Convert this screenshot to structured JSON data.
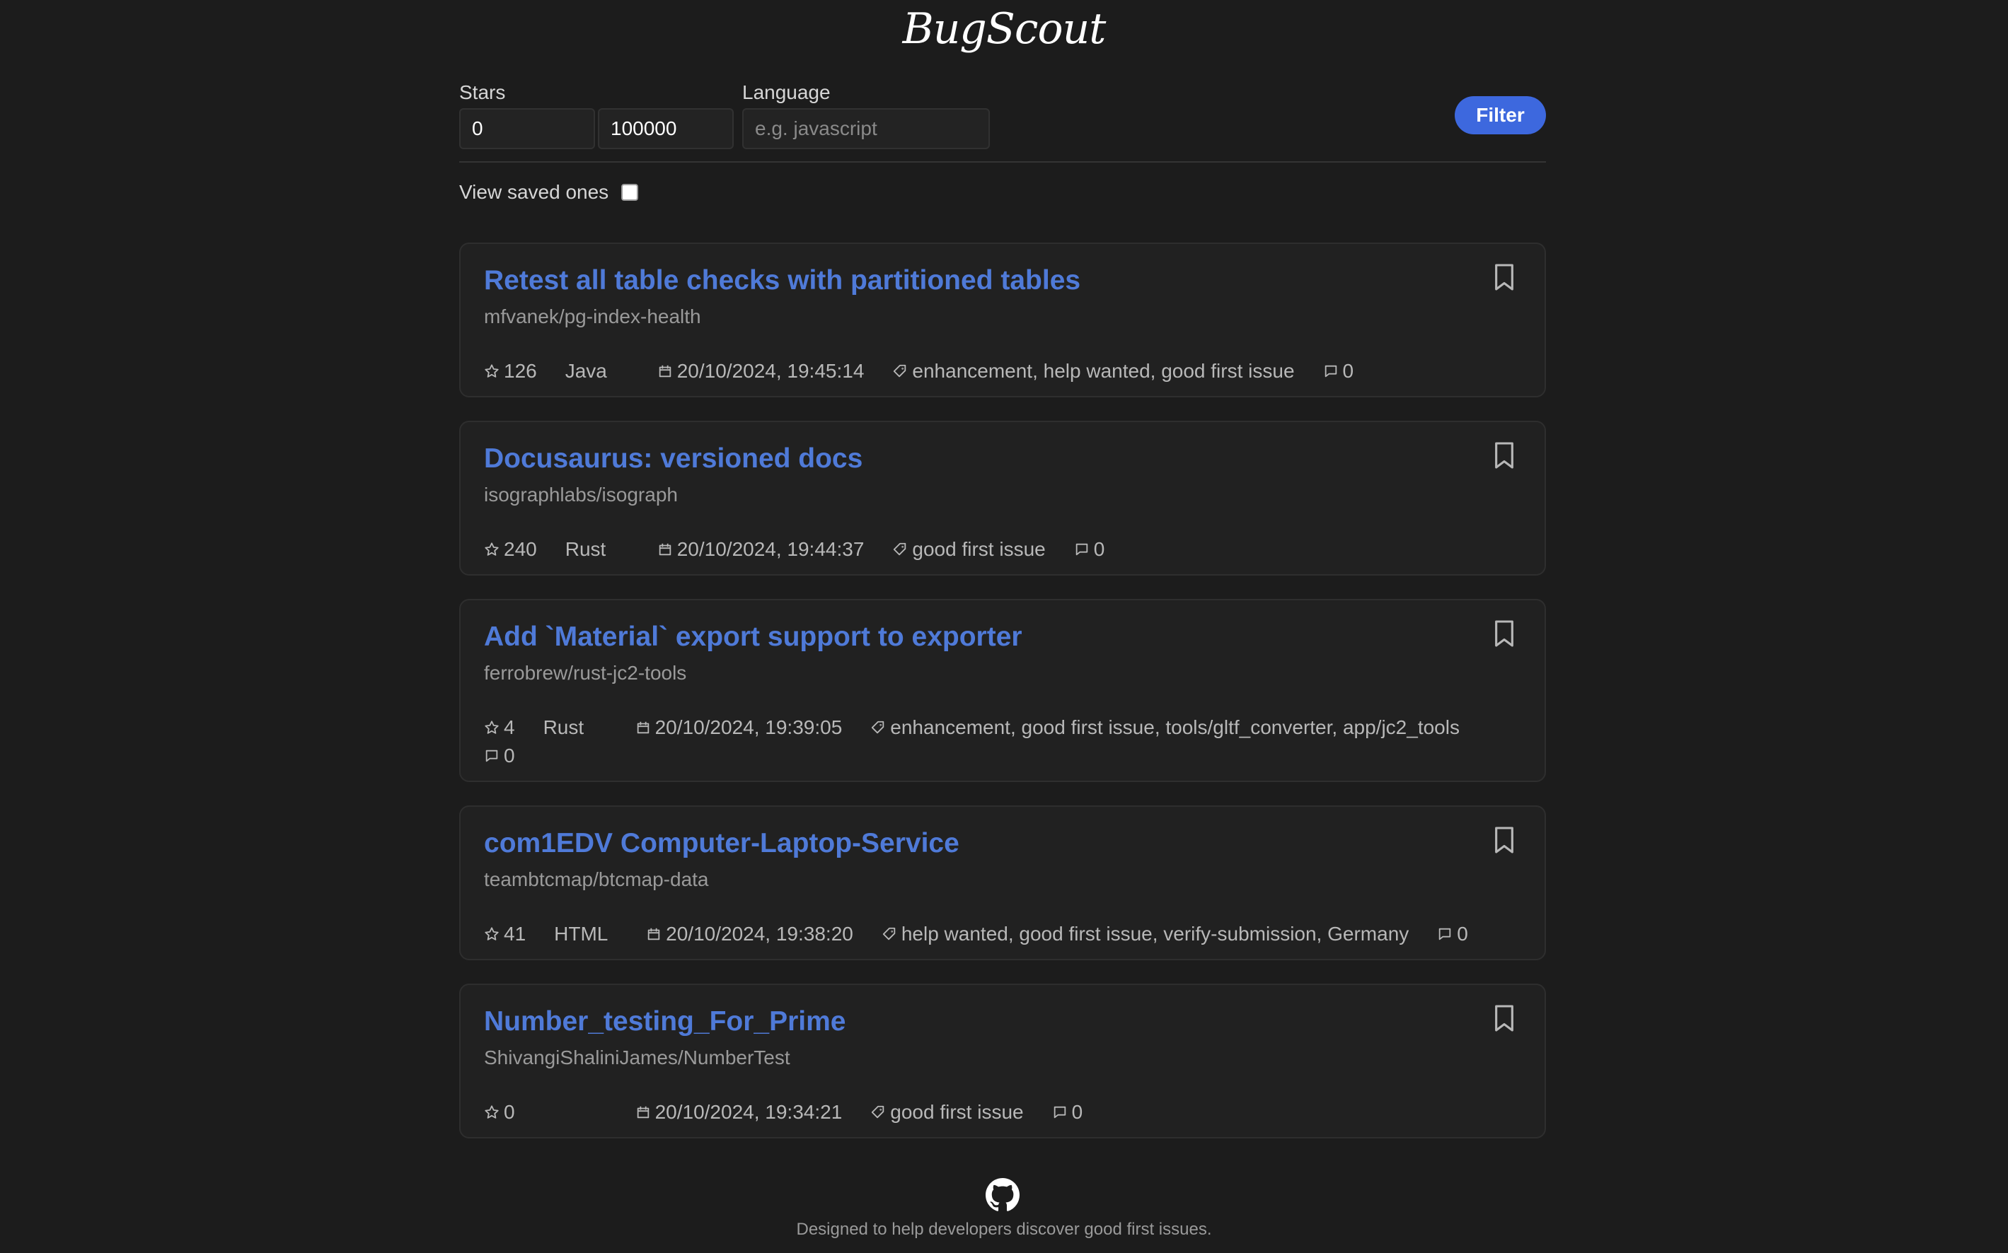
{
  "app": {
    "title": "BugScout"
  },
  "filters": {
    "stars_label": "Stars",
    "stars_min": "0",
    "stars_max": "100000",
    "language_label": "Language",
    "language_placeholder": "e.g. javascript",
    "filter_button": "Filter"
  },
  "saved": {
    "label": "View saved ones",
    "checked": false
  },
  "issues": [
    {
      "title": "Retest all table checks with partitioned tables",
      "repo": "mfvanek/pg-index-health",
      "stars": "126",
      "language": "Java",
      "date": "20/10/2024, 19:45:14",
      "labels": "enhancement, help wanted, good first issue",
      "comments": "0"
    },
    {
      "title": "Docusaurus: versioned docs",
      "repo": "isographlabs/isograph",
      "stars": "240",
      "language": "Rust",
      "date": "20/10/2024, 19:44:37",
      "labels": "good first issue",
      "comments": "0"
    },
    {
      "title": "Add `Material` export support to exporter",
      "repo": "ferrobrew/rust-jc2-tools",
      "stars": "4",
      "language": "Rust",
      "date": "20/10/2024, 19:39:05",
      "labels": "enhancement, good first issue, tools/gltf_converter, app/jc2_tools",
      "comments": "0"
    },
    {
      "title": "com1EDV Computer-Laptop-Service",
      "repo": "teambtcmap/btcmap-data",
      "stars": "41",
      "language": "HTML",
      "date": "20/10/2024, 19:38:20",
      "labels": "help wanted, good first issue, verify-submission, Germany",
      "comments": "0"
    },
    {
      "title": "Number_testing_For_Prime",
      "repo": "ShivangiShaliniJames/NumberTest",
      "stars": "0",
      "language": "",
      "date": "20/10/2024, 19:34:21",
      "labels": "good first issue",
      "comments": "0"
    }
  ],
  "footer": {
    "icon": "github-icon",
    "text": "Designed to help developers discover good first issues."
  },
  "colors": {
    "background": "#1c1c1c",
    "card": "#212121",
    "accent": "#3d68de",
    "title_link": "#4f7ad8"
  }
}
